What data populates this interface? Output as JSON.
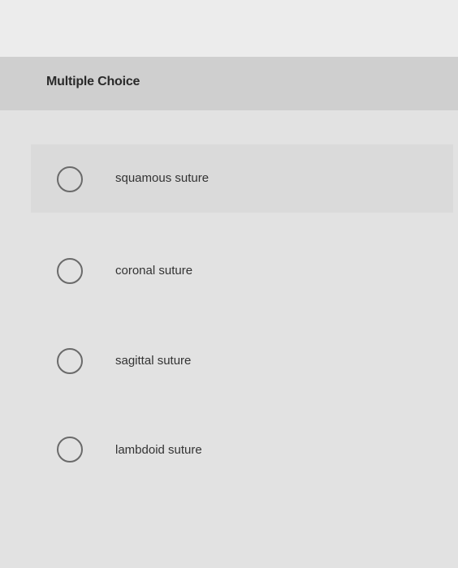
{
  "question": {
    "type_label": "Multiple Choice",
    "options": [
      {
        "label": "squamous suture"
      },
      {
        "label": "coronal suture"
      },
      {
        "label": "sagittal suture"
      },
      {
        "label": "lambdoid suture"
      }
    ]
  }
}
